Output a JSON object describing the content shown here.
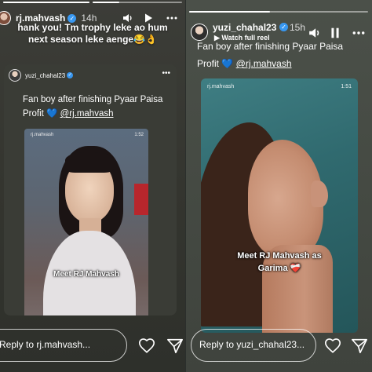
{
  "left_story": {
    "username": "rj.mahvash",
    "time": "14h",
    "reply_text_line1": "hank you! Tm trophy leke ao hum",
    "reply_text_line2": "next season leke aenge😂👌",
    "shared_post": {
      "username": "yuzi_chahal23",
      "caption_line1": "Fan boy after finishing Pyaar Paisa",
      "caption_line2_prefix": "Profit",
      "caption_heart": "💙",
      "caption_mention": "@rj.mahvash",
      "reel": {
        "username": "rj.mahvash",
        "duration": "1:52",
        "overlay_label": "Meet RJ Mahvash"
      }
    },
    "reply_placeholder": "Reply to rj.mahvash..."
  },
  "right_story": {
    "username": "yuzi_chahal23",
    "time": "15h",
    "watch_label": "Watch full reel",
    "caption_line1": "Fan boy after finishing Pyaar Paisa",
    "caption_line2_prefix": "Profit",
    "caption_heart": "💙",
    "caption_mention": "@rj.mahvash",
    "reel": {
      "username": "rj.mahvash",
      "duration": "1:51",
      "overlay_label_line1": "Meet RJ Mahvash as",
      "overlay_label_line2": "Garima",
      "overlay_heart": "❤️‍🩹"
    },
    "reply_placeholder": "Reply to yuzi_chahal23..."
  },
  "icons": [
    "mute-icon",
    "play-icon",
    "more-icon",
    "pause-icon",
    "heart-icon",
    "send-icon",
    "verified-icon"
  ],
  "colors": {
    "verified": "#3897f0",
    "background": "#2b2f2c"
  }
}
